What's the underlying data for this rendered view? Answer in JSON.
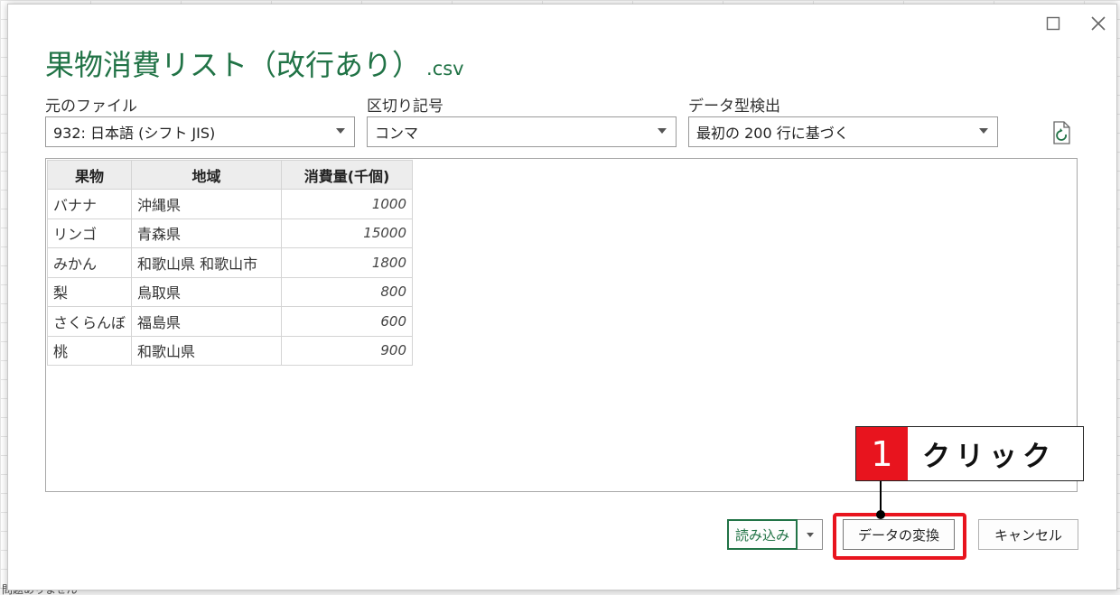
{
  "background": {
    "status_text": "問題ありません"
  },
  "dialog": {
    "title": "果物消費リスト（改行あり）",
    "title_ext": ".csv",
    "window_buttons": {
      "maximize_icon": "maximize-icon",
      "close_icon": "close-icon"
    },
    "fields": {
      "origin": {
        "label": "元のファイル",
        "value": "932: 日本語 (シフト JIS)"
      },
      "delimiter": {
        "label": "区切り記号",
        "value": "コンマ"
      },
      "type_detection": {
        "label": "データ型検出",
        "value": "最初の 200 行に基づく"
      }
    },
    "refresh_icon": "refresh-document-icon",
    "table": {
      "headers": [
        "果物",
        "地域",
        "消費量(千個)"
      ],
      "rows": [
        [
          "バナナ",
          "沖縄県",
          "1000"
        ],
        [
          "リンゴ",
          "青森県",
          "15000"
        ],
        [
          "みかん",
          "和歌山県 和歌山市",
          "1800"
        ],
        [
          "梨",
          "鳥取県",
          "800"
        ],
        [
          "さくらんぼ",
          "福島県",
          "600"
        ],
        [
          "桃",
          "和歌山県",
          "900"
        ]
      ]
    },
    "buttons": {
      "load": "読み込み",
      "transform": "データの変換",
      "cancel": "キャンセル"
    }
  },
  "annotation": {
    "number": "1",
    "text": "クリック",
    "color": "#e8141e"
  },
  "colors": {
    "accent": "#217346",
    "highlight": "#e8141e"
  }
}
